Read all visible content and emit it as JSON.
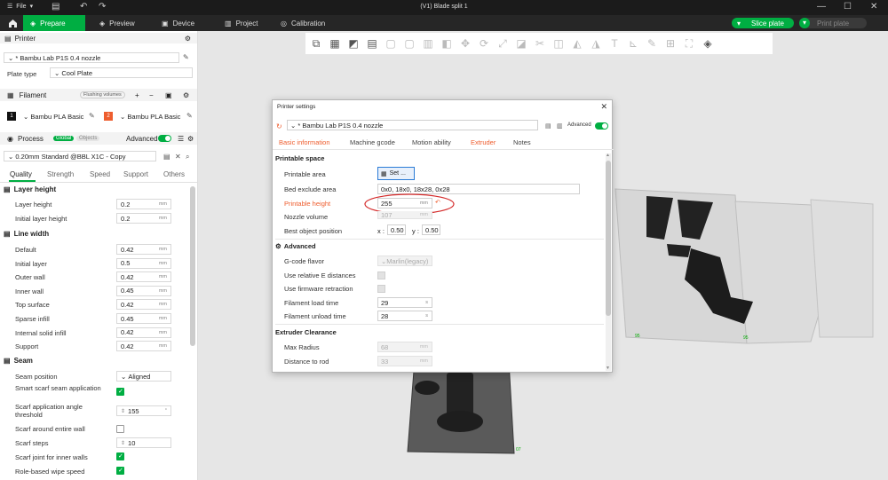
{
  "titlebar": {
    "file": "File",
    "window_title": "(V1) Blade split 1"
  },
  "tabs": [
    {
      "label": "Prepare"
    },
    {
      "label": "Preview"
    },
    {
      "label": "Device"
    },
    {
      "label": "Project"
    },
    {
      "label": "Calibration"
    }
  ],
  "actions": {
    "slice": "Slice plate",
    "print": "Print plate"
  },
  "accent": "#00ae42",
  "printer": {
    "header": "Printer",
    "name": "* Bambu Lab P1S 0.4 nozzle",
    "plate_type_label": "Plate type",
    "plate_type": "Cool Plate"
  },
  "filament": {
    "header": "Filament",
    "flushing": "Flushing volumes",
    "slots": [
      {
        "num": "1",
        "name": "Bambu PLA Basic",
        "color": "#111111"
      },
      {
        "num": "2",
        "name": "Bambu PLA Basic",
        "color": "#ee5d2e"
      }
    ]
  },
  "process": {
    "header": "Process",
    "global": "Global",
    "objects": "Objects",
    "advanced": "Advanced",
    "preset": "0.20mm Standard @BBL X1C - Copy",
    "tabs": [
      "Quality",
      "Strength",
      "Speed",
      "Support",
      "Others"
    ],
    "groups": {
      "layer_height": "Layer height",
      "line_width": "Line width",
      "seam": "Seam"
    },
    "layer_height": [
      {
        "label": "Layer height",
        "value": "0.2",
        "unit": "mm"
      },
      {
        "label": "Initial layer height",
        "value": "0.2",
        "unit": "mm"
      }
    ],
    "line_width": [
      {
        "label": "Default",
        "value": "0.42",
        "unit": "mm"
      },
      {
        "label": "Initial layer",
        "value": "0.5",
        "unit": "mm"
      },
      {
        "label": "Outer wall",
        "value": "0.42",
        "unit": "mm"
      },
      {
        "label": "Inner wall",
        "value": "0.45",
        "unit": "mm"
      },
      {
        "label": "Top surface",
        "value": "0.42",
        "unit": "mm"
      },
      {
        "label": "Sparse infill",
        "value": "0.45",
        "unit": "mm"
      },
      {
        "label": "Internal solid infill",
        "value": "0.42",
        "unit": "mm"
      },
      {
        "label": "Support",
        "value": "0.42",
        "unit": "mm"
      }
    ],
    "seam": {
      "position_label": "Seam position",
      "position": "Aligned",
      "smart_label": "Smart scarf seam application",
      "angle_label": "Scarf application angle threshold",
      "angle": "155",
      "unit_deg": "°",
      "around_label": "Scarf around entire wall",
      "steps_label": "Scarf steps",
      "steps": "10",
      "inner_label": "Scarf joint for inner walls",
      "role_label": "Role-based wipe speed"
    }
  },
  "dialog": {
    "title": "Printer settings",
    "preset": "* Bambu Lab P1S 0.4 nozzle",
    "advanced": "Advanced",
    "tabs": [
      "Basic information",
      "Machine gcode",
      "Motion ability",
      "Extruder",
      "Notes"
    ],
    "printable_space": "Printable space",
    "printable_area_label": "Printable area",
    "set_button": "Set ...",
    "bed_exclude_label": "Bed exclude area",
    "bed_exclude": "0x0, 18x0, 18x28, 0x28",
    "printable_height_label": "Printable height",
    "printable_height": "255",
    "mm": "mm",
    "nozzle_volume_label": "Nozzle volume",
    "nozzle_volume": "107",
    "best_pos_label": "Best object position",
    "x_label": "x :",
    "x_val": "0.50",
    "y_label": "y :",
    "y_val": "0.50",
    "advanced_head": "Advanced",
    "gcode_flavor_label": "G-code flavor",
    "gcode_flavor": "Marlin(legacy)",
    "rel_e_label": "Use relative E distances",
    "fw_retract_label": "Use firmware retraction",
    "load_label": "Filament load time",
    "load_val": "29",
    "unload_label": "Filament unload time",
    "unload_val": "28",
    "s": "s",
    "clearance_head": "Extruder Clearance",
    "max_radius_label": "Max Radius",
    "max_radius": "68",
    "dist_rod_label": "Distance to rod",
    "dist_rod": "33"
  },
  "plate_labels": {
    "a": "95",
    "b": "95",
    "c": "07"
  }
}
